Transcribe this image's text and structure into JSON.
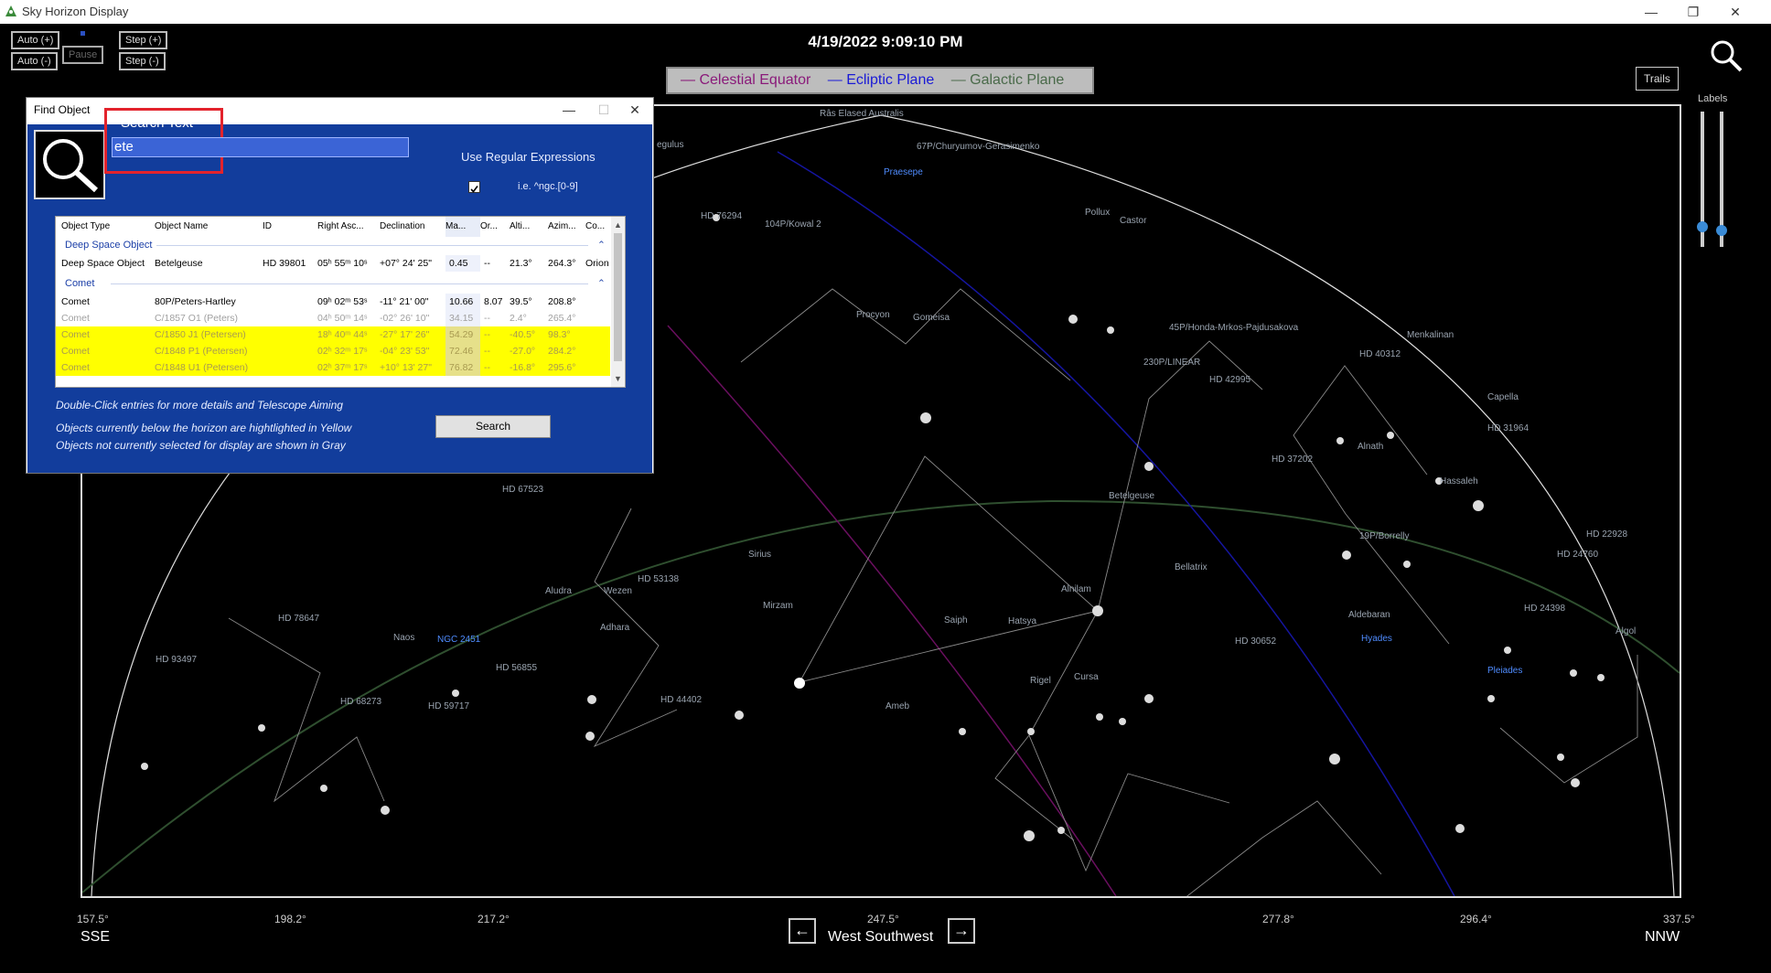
{
  "window": {
    "title": "Sky Horizon Display"
  },
  "controls": {
    "auto_plus": "Auto (+)",
    "auto_minus": "Auto (-)",
    "pause": "Pause",
    "step_plus": "Step (+)",
    "step_minus": "Step (-)"
  },
  "datetime": "4/19/2022 9:09:10 PM",
  "legend": [
    {
      "label": "Celestial Equator",
      "color": "#8a1a7a"
    },
    {
      "label": "Ecliptic Plane",
      "color": "#1a1ad6"
    },
    {
      "label": "Galactic Plane",
      "color": "#4a6a4a"
    }
  ],
  "right_panel": {
    "trails": "Trails",
    "labels": "Labels"
  },
  "axis": {
    "ticks": [
      "157.5°",
      "198.2°",
      "217.2°",
      "247.5°",
      "277.8°",
      "296.4°",
      "337.5°"
    ],
    "left_dir": "SSE",
    "center_dir": "West Southwest",
    "right_dir": "NNW"
  },
  "sky_labels": [
    {
      "t": "Râs Elased Australis"
    },
    {
      "t": "egulus"
    },
    {
      "t": "67P/Churyumov-Gerasimenko"
    },
    {
      "t": "Praesepe",
      "blue": true
    },
    {
      "t": "HD 76294"
    },
    {
      "t": "104P/Kowal 2"
    },
    {
      "t": "Pollux"
    },
    {
      "t": "Castor"
    },
    {
      "t": "Procyon"
    },
    {
      "t": "Gomeisa"
    },
    {
      "t": "45P/Honda-Mrkos-Pajdusakova"
    },
    {
      "t": "Menkalinan"
    },
    {
      "t": "HD 40312"
    },
    {
      "t": "230P/LINEAR"
    },
    {
      "t": "HD 42995"
    },
    {
      "t": "Capella"
    },
    {
      "t": "HD 31964"
    },
    {
      "t": "Alnath"
    },
    {
      "t": "HD 37202"
    },
    {
      "t": "Hassaleh"
    },
    {
      "t": "HD 67523"
    },
    {
      "t": "Betelgeuse"
    },
    {
      "t": "19P/Borrelly"
    },
    {
      "t": "HD 22928"
    },
    {
      "t": "HD 24760"
    },
    {
      "t": "Sirius"
    },
    {
      "t": "Bellatrix"
    },
    {
      "t": "HD 53138"
    },
    {
      "t": "Aludra"
    },
    {
      "t": "Wezen"
    },
    {
      "t": "Alnilam"
    },
    {
      "t": "Mirzam"
    },
    {
      "t": "HD 24398"
    },
    {
      "t": "Aldebaran"
    },
    {
      "t": "HD 78647"
    },
    {
      "t": "Adhara"
    },
    {
      "t": "Saiph"
    },
    {
      "t": "Hatsya"
    },
    {
      "t": "Hyades",
      "blue": true
    },
    {
      "t": "Algol"
    },
    {
      "t": "Naos"
    },
    {
      "t": "NGC 2451",
      "blue": true
    },
    {
      "t": "HD 30652"
    },
    {
      "t": "HD 93497"
    },
    {
      "t": "HD 56855"
    },
    {
      "t": "Pleiades",
      "blue": true
    },
    {
      "t": "Rigel"
    },
    {
      "t": "Cursa"
    },
    {
      "t": "HD 68273"
    },
    {
      "t": "HD 59717"
    },
    {
      "t": "HD 44402"
    },
    {
      "t": "Ameb"
    }
  ],
  "find_dialog": {
    "title": "Find Object",
    "search_label": "Search Text",
    "search_value": "ete",
    "regex_label": "Use Regular Expressions",
    "regex_example": "i.e.   ^ngc.[0-9]",
    "columns": [
      "Object Type",
      "Object Name",
      "ID",
      "Right Asc...",
      "Declination",
      "Ma...",
      "Or...",
      "Alti...",
      "Azim...",
      "Co..."
    ],
    "groups": [
      {
        "name": "Deep Space Object",
        "rows": [
          {
            "type": "Deep Space Object",
            "name": "Betelgeuse",
            "id": "HD 39801",
            "ra": "05ʰ 55ᵐ 10ˢ",
            "dec": "+07° 24' 25\"",
            "mag": "0.45",
            "or": "--",
            "alt": "21.3°",
            "az": "264.3°",
            "co": "Orion",
            "style": "normal"
          }
        ]
      },
      {
        "name": "Comet",
        "rows": [
          {
            "type": "Comet",
            "name": "80P/Peters-Hartley",
            "id": "",
            "ra": "09ʰ 02ᵐ 53ˢ",
            "dec": "-11° 21' 00\"",
            "mag": "10.66",
            "or": "8.07",
            "alt": "39.5°",
            "az": "208.8°",
            "co": "",
            "style": "normal"
          },
          {
            "type": "Comet",
            "name": "C/1857 O1 (Peters)",
            "id": "",
            "ra": "04ʰ 50ᵐ 14ˢ",
            "dec": "-02° 26' 10\"",
            "mag": "34.15",
            "or": "--",
            "alt": "2.4°",
            "az": "265.4°",
            "co": "",
            "style": "gray"
          },
          {
            "type": "Comet",
            "name": "C/1850 J1 (Petersen)",
            "id": "",
            "ra": "18ʰ 40ᵐ 44ˢ",
            "dec": "-27° 17' 26\"",
            "mag": "54.29",
            "or": "--",
            "alt": "-40.5°",
            "az": "98.3°",
            "co": "",
            "style": "yellow"
          },
          {
            "type": "Comet",
            "name": "C/1848 P1 (Petersen)",
            "id": "",
            "ra": "02ʰ 32ᵐ 17ˢ",
            "dec": "-04° 23' 53\"",
            "mag": "72.46",
            "or": "--",
            "alt": "-27.0°",
            "az": "284.2°",
            "co": "",
            "style": "yellow"
          },
          {
            "type": "Comet",
            "name": "C/1848 U1 (Petersen)",
            "id": "",
            "ra": "02ʰ 37ᵐ 17ˢ",
            "dec": "+10° 13' 27\"",
            "mag": "76.82",
            "or": "--",
            "alt": "-16.8°",
            "az": "295.6°",
            "co": "",
            "style": "yellow"
          }
        ]
      }
    ],
    "hint1": "Double-Click entries for more details and Telescope Aiming",
    "hint2": "Objects currently below the horizon are hightlighted in Yellow",
    "hint3": "Objects not currently selected for display are shown in Gray",
    "search_button": "Search"
  }
}
